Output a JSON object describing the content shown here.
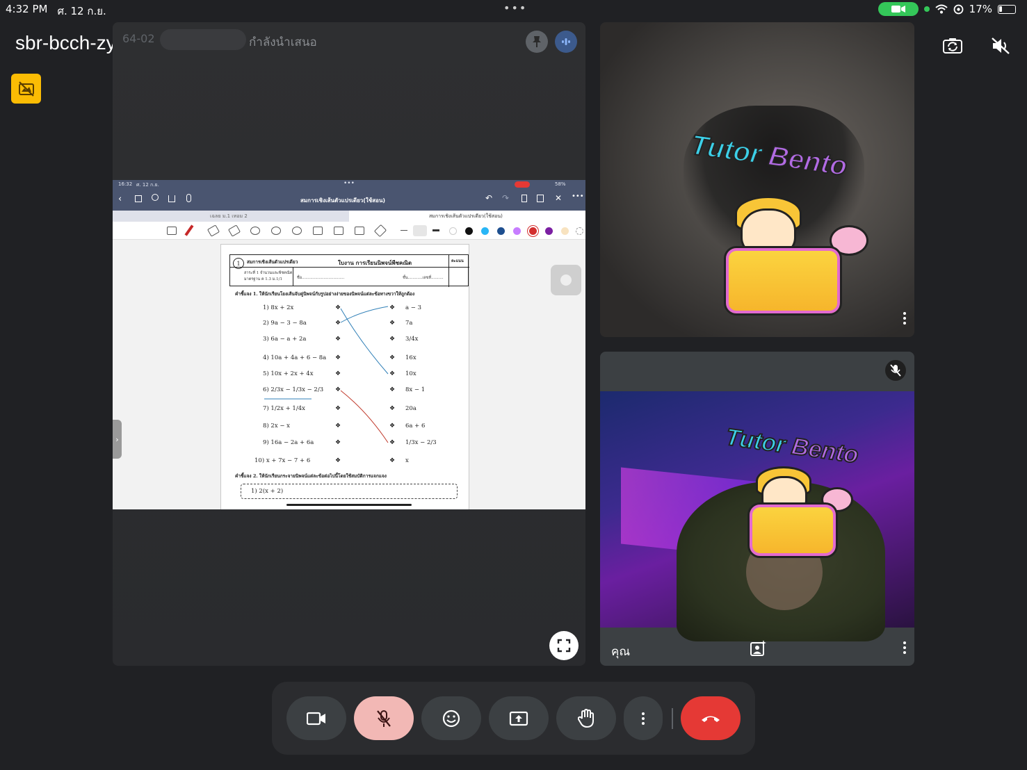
{
  "status_bar": {
    "time": "4:32 PM",
    "date": "ศ. 12 ก.ย.",
    "battery": "17%",
    "icons": [
      "camera-indicator-icon",
      "wifi-icon",
      "location-icon",
      "battery-icon"
    ]
  },
  "meeting": {
    "code": "sbr-bcch-zyg"
  },
  "presentation": {
    "badge": "64-02",
    "label": "กำลังนำเสนอ"
  },
  "shared_screen": {
    "status_time": "16:32",
    "status_date": "ศ. 12 ก.ย.",
    "status_battery": "58%",
    "doc_title": "สมการเชิงเส้นตัวแปรเดียว(ใช้สอน)",
    "tab_left": "เฉลย ม.1 เทอม 2",
    "tab_right": "สมการเชิงเส้นตัวแปรเดียว(ใช้สอน)",
    "worksheet": {
      "sheet_no": "1",
      "head_left": "สมการเชิงเส้นตัวแปรเดียว",
      "head_center": "ใบงาน การเรียนนิพจน์พีชคณิต",
      "head_right": "คะแนน",
      "sub_left_1": "สาระที่ 1 จำนวนและพีชคณิต",
      "sub_left_2": "มาตรฐาน ค 1.3 ม.1/1",
      "sub_name": "ชื่อ...................................",
      "sub_class": "ชั้น............เลขที่..........",
      "instruction_1": "คำชี้แจง 1. ให้นักเรียนโยงเส้นจับคู่นิพจน์กับรูปอย่างง่ายของนิพจน์แต่ละข้อทางขวาให้ถูกต้อง",
      "left_items": [
        "1)  8x + 2x",
        "2)  9a − 3 − 8a",
        "3)  6a − a + 2a",
        "4)  10a + 4a + 6 − 8a",
        "5)  10x + 2x + 4x",
        "6)  2/3x − 1/3x − 2/3",
        "7)  1/2x + 1/4x",
        "8)  2x − x",
        "9)  16a − 2a + 6a",
        "10)  x + 7x − 7 + 6"
      ],
      "right_items": [
        "a − 3",
        "7a",
        "3/4x",
        "16x",
        "10x",
        "8x − 1",
        "20a",
        "6a + 6",
        "1/3x − 2/3",
        "x"
      ],
      "instruction_2": "คำชี้แจง 2. ให้นักเรียนกระจายนิพจน์แต่ละข้อต่อไปนี้โดยใช้สมบัติการแจกแจง",
      "exercise_2": "1)   2(x + 2)"
    }
  },
  "participants": [
    {
      "name": "",
      "sticker": {
        "title_1": "Tutor",
        "title_2": "Bento"
      }
    },
    {
      "name": "คุณ",
      "sticker": {
        "title_1": "Tutor",
        "title_2": "Bento"
      }
    }
  ],
  "controls": {
    "camera": "video-camera-icon",
    "mic": "mic-off-icon",
    "reactions": "emoji-icon",
    "present": "present-screen-icon",
    "raise_hand": "raise-hand-icon",
    "more": "more-vertical-icon",
    "end": "end-call-icon"
  },
  "colors": {
    "background": "#202124",
    "mic_off_bg": "#f2b8b5",
    "end_call": "#e53935",
    "accent_yellow": "#fbbc04"
  }
}
